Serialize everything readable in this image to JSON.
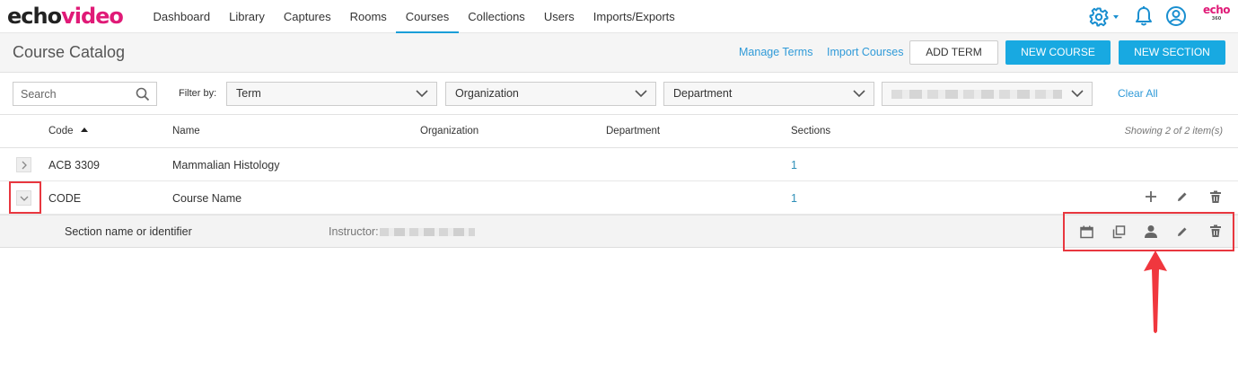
{
  "brand": {
    "part1": "echo",
    "part2": "video",
    "brand_color": "#e01a77"
  },
  "nav": {
    "items": [
      {
        "label": "Dashboard"
      },
      {
        "label": "Library"
      },
      {
        "label": "Captures"
      },
      {
        "label": "Rooms"
      },
      {
        "label": "Courses",
        "active": true
      },
      {
        "label": "Collections"
      },
      {
        "label": "Users"
      },
      {
        "label": "Imports/Exports"
      }
    ],
    "right_icons": [
      "gear-icon",
      "bell-icon",
      "user-circle-icon",
      "echo360-logo"
    ],
    "echo360_logo_text": "echo",
    "echo360_logo_sub": "360"
  },
  "subheader": {
    "title": "Course Catalog",
    "manage_terms": "Manage Terms",
    "import_courses": "Import Courses",
    "add_term": "ADD TERM",
    "new_course": "NEW COURSE",
    "new_section": "NEW SECTION",
    "accent_color": "#18a9e1"
  },
  "filters": {
    "search_placeholder": "Search",
    "filter_by": "Filter by:",
    "term": "Term",
    "organization": "Organization",
    "department": "Department",
    "clear_all": "Clear All"
  },
  "table": {
    "columns": {
      "code": "Code",
      "name": "Name",
      "organization": "Organization",
      "department": "Department",
      "sections": "Sections"
    },
    "showing": "Showing 2 of 2 item(s)",
    "rows": [
      {
        "code": "ACB 3309",
        "name": "Mammalian Histology",
        "organization": "",
        "department": "",
        "sections": "1",
        "expanded": false
      },
      {
        "code": "CODE",
        "name": "Course Name",
        "organization": "",
        "department": "",
        "sections": "1",
        "expanded": true
      }
    ],
    "section": {
      "name": "Section name or identifier",
      "instructor_label": "Instructor:"
    }
  },
  "annotation_color": "#e8373f"
}
